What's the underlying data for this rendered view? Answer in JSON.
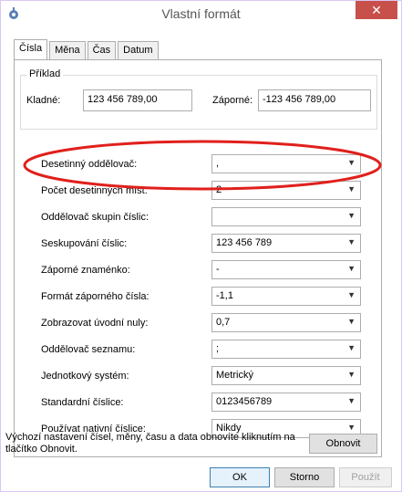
{
  "window": {
    "title": "Vlastní formát",
    "close_symbol": "✕"
  },
  "tabs": [
    {
      "label": "Čísla",
      "active": true
    },
    {
      "label": "Měna",
      "active": false
    },
    {
      "label": "Čas",
      "active": false
    },
    {
      "label": "Datum",
      "active": false
    }
  ],
  "sample": {
    "group_label": "Příklad",
    "positive_label": "Kladné:",
    "positive_value": "123 456 789,00",
    "negative_label": "Záporné:",
    "negative_value": "-123 456 789,00"
  },
  "settings": [
    {
      "label": "Desetinný oddělovač:",
      "value": ",",
      "highlighted": true
    },
    {
      "label": "Počet desetinných míst:",
      "value": "2"
    },
    {
      "label": "Oddělovač skupin číslic:",
      "value": ""
    },
    {
      "label": "Seskupování číslic:",
      "value": "123 456 789"
    },
    {
      "label": "Záporné znaménko:",
      "value": "-"
    },
    {
      "label": "Formát záporného čísla:",
      "value": "-1,1"
    },
    {
      "label": "Zobrazovat úvodní nuly:",
      "value": "0,7"
    },
    {
      "label": "Oddělovač seznamu:",
      "value": ";"
    },
    {
      "label": "Jednotkový systém:",
      "value": "Metrický"
    },
    {
      "label": "Standardní číslice:",
      "value": "0123456789"
    },
    {
      "label": "Používat nativní číslice:",
      "value": "Nikdy"
    }
  ],
  "footer": {
    "note": "Výchozí nastavení čísel, měny, času a data obnovíte kliknutím na tlačítko Obnovit.",
    "reset_label": "Obnovit"
  },
  "buttons": {
    "ok": "OK",
    "cancel": "Storno",
    "apply": "Použít"
  },
  "colors": {
    "close_button": "#c7504b",
    "annotation": "#e0201c"
  }
}
